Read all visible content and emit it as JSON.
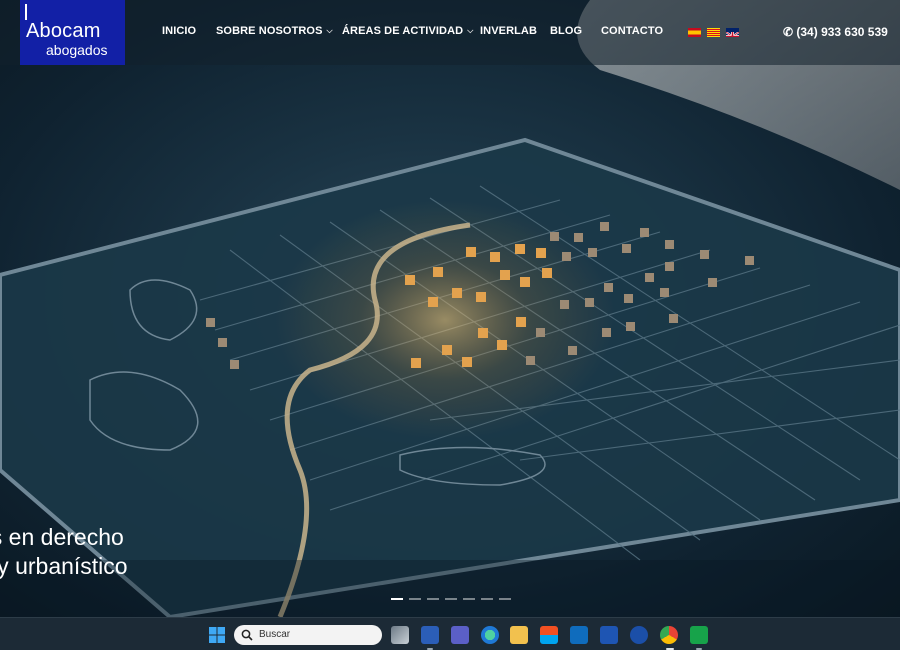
{
  "logo": {
    "line1": "Abocam",
    "line2": "abogados"
  },
  "nav": {
    "items": [
      {
        "label": "INICIO",
        "has_dropdown": false
      },
      {
        "label": "SOBRE NOSOTROS",
        "has_dropdown": true
      },
      {
        "label": "ÁREAS DE ACTIVIDAD",
        "has_dropdown": true
      },
      {
        "label": "INVERLAB",
        "has_dropdown": false
      },
      {
        "label": "BLOG",
        "has_dropdown": false
      },
      {
        "label": "CONTACTO",
        "has_dropdown": false
      }
    ],
    "chevron": "⌵",
    "languages": [
      "es-flag-icon",
      "ca-flag-icon",
      "en-flag-icon"
    ],
    "phone": "(34) 933 630 539"
  },
  "hero": {
    "headline_line1": "us en derecho",
    "headline_line2": "o y urbanístico",
    "slides": 7,
    "active_slide": 0
  },
  "taskbar": {
    "search_placeholder": "Buscar",
    "apps": [
      "task-view-icon",
      "word-icon",
      "teams-icon",
      "edge-icon",
      "file-explorer-icon",
      "store-icon",
      "outlook-icon",
      "lync-icon",
      "app-icon",
      "chrome-icon",
      "screen-tool-icon"
    ]
  },
  "colors": {
    "logo_bg": "#1220a6",
    "header_bg": "#12202c",
    "taskbar_bg": "#1c2a36"
  }
}
